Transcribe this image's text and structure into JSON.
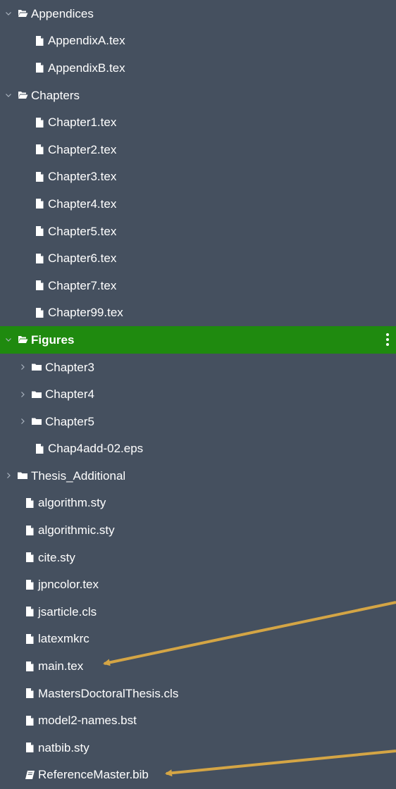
{
  "tree": [
    {
      "label": "Appendices",
      "type": "folder-open",
      "level": 0,
      "expanded": true
    },
    {
      "label": "AppendixA.tex",
      "type": "file",
      "level": 1
    },
    {
      "label": "AppendixB.tex",
      "type": "file",
      "level": 1
    },
    {
      "label": "Chapters",
      "type": "folder-open",
      "level": 0,
      "expanded": true
    },
    {
      "label": "Chapter1.tex",
      "type": "file",
      "level": 1
    },
    {
      "label": "Chapter2.tex",
      "type": "file",
      "level": 1
    },
    {
      "label": "Chapter3.tex",
      "type": "file",
      "level": 1
    },
    {
      "label": "Chapter4.tex",
      "type": "file",
      "level": 1
    },
    {
      "label": "Chapter5.tex",
      "type": "file",
      "level": 1
    },
    {
      "label": "Chapter6.tex",
      "type": "file",
      "level": 1
    },
    {
      "label": "Chapter7.tex",
      "type": "file",
      "level": 1
    },
    {
      "label": "Chapter99.tex",
      "type": "file",
      "level": 1
    },
    {
      "label": "Figures",
      "type": "folder-open",
      "level": 0,
      "expanded": true,
      "selected": true
    },
    {
      "label": "Chapter3",
      "type": "folder",
      "level": 1,
      "expanded": false
    },
    {
      "label": "Chapter4",
      "type": "folder",
      "level": 1,
      "expanded": false
    },
    {
      "label": "Chapter5",
      "type": "folder",
      "level": 1,
      "expanded": false
    },
    {
      "label": "Chap4add-02.eps",
      "type": "file",
      "level": 1
    },
    {
      "label": "Thesis_Additional",
      "type": "folder",
      "level": 0,
      "expanded": false
    },
    {
      "label": "algorithm.sty",
      "type": "file",
      "level": 0
    },
    {
      "label": "algorithmic.sty",
      "type": "file",
      "level": 0
    },
    {
      "label": "cite.sty",
      "type": "file",
      "level": 0
    },
    {
      "label": "jpncolor.tex",
      "type": "file",
      "level": 0
    },
    {
      "label": "jsarticle.cls",
      "type": "file",
      "level": 0
    },
    {
      "label": "latexmkrc",
      "type": "file",
      "level": 0
    },
    {
      "label": "main.tex",
      "type": "file",
      "level": 0
    },
    {
      "label": "MastersDoctoralThesis.cls",
      "type": "file",
      "level": 0
    },
    {
      "label": "model2-names.bst",
      "type": "file",
      "level": 0
    },
    {
      "label": "natbib.sty",
      "type": "file",
      "level": 0
    },
    {
      "label": "ReferenceMaster.bib",
      "type": "bib",
      "level": 0
    }
  ],
  "colors": {
    "background": "#45505f",
    "selected_row": "#1f8a0f",
    "arrow": "#d4a545",
    "text": "#ffffff"
  },
  "icons": {
    "folder_open": "folder-open-icon",
    "folder_closed": "folder-icon",
    "file": "file-icon",
    "bib": "book-icon",
    "menu": "vertical-dots-icon"
  }
}
